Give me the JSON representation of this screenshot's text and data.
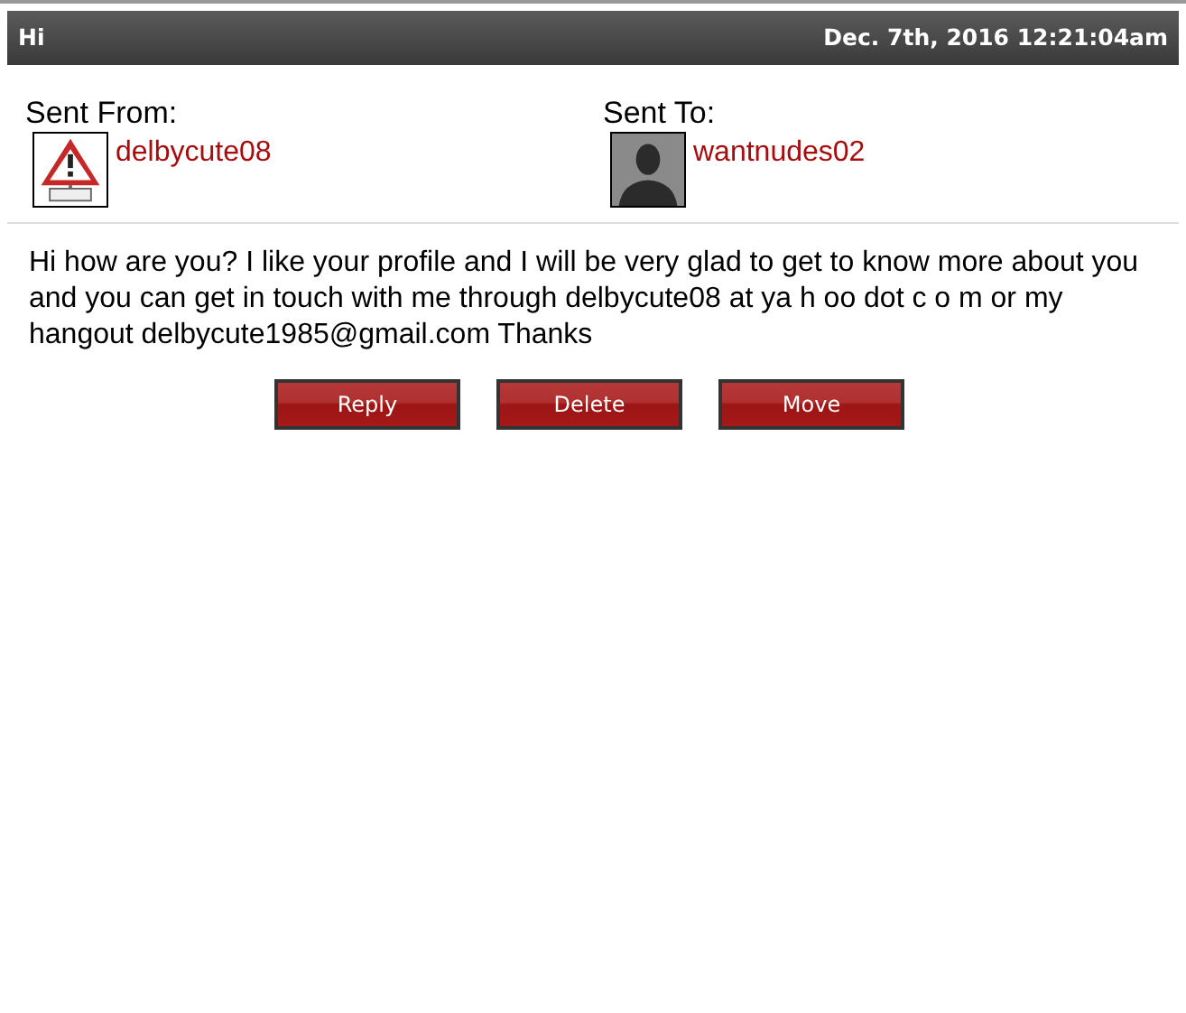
{
  "header": {
    "subject": "Hi",
    "date": "Dec. 7th, 2016 12:21:04am"
  },
  "parties": [
    {
      "label": "Sent From:",
      "username": "delbycute08",
      "kind": "picture"
    },
    {
      "label": "Sent To:",
      "username": "wantnudes02",
      "kind": "silhouette"
    }
  ],
  "message": "Hi how are you? I like your profile and I will be very glad to get to know more about you and you can get in touch with me through delbycute08 at ya h oo dot c o m or my hangout delbycute1985@gmail.com Thanks",
  "buttons": [
    "Reply",
    "Delete",
    "Move"
  ]
}
